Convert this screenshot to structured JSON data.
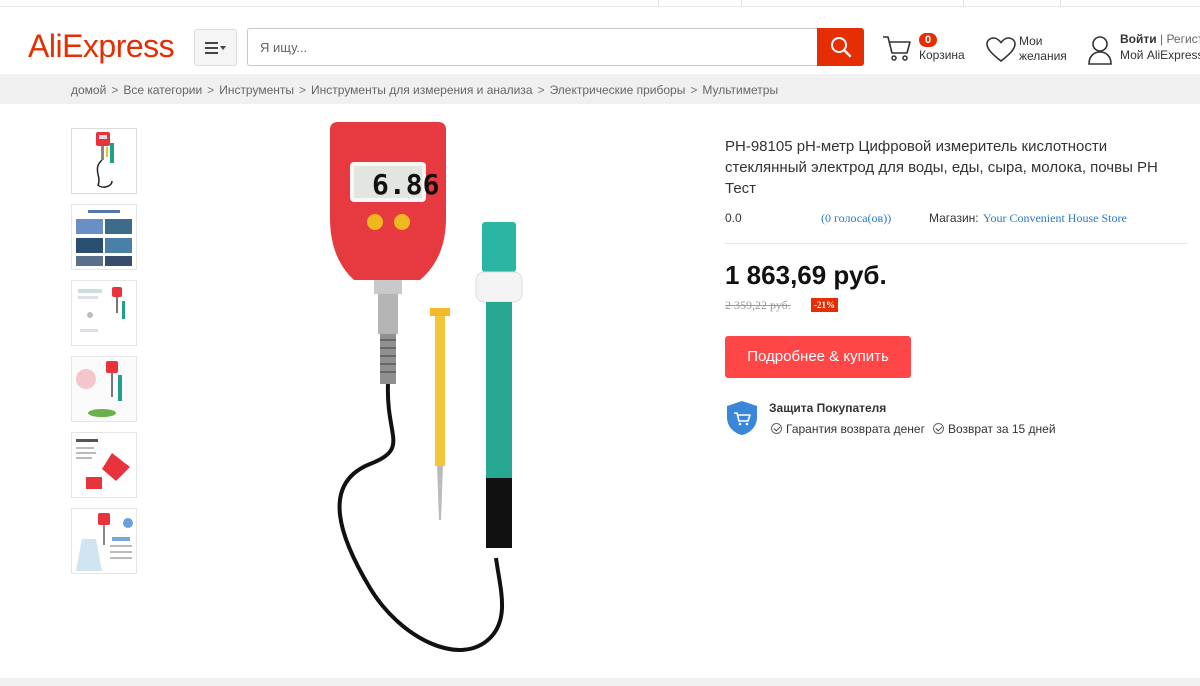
{
  "header": {
    "logo": "AliExpress",
    "search_placeholder": "Я ищу...",
    "cart_count": "0",
    "cart_label": "Корзина",
    "wishlist_line1": "Мои",
    "wishlist_line2": "желания",
    "signin": "Войти",
    "register": "Регистрация",
    "account": "Мой AliExpress"
  },
  "breadcrumb": {
    "items": [
      "домой",
      "Все категории",
      "Инструменты",
      "Инструменты для измерения и анализа",
      "Электрические приборы",
      "Мультиметры"
    ],
    "separator": ">"
  },
  "thumbnails": [
    {
      "name": "thumb-ph-meter"
    },
    {
      "name": "thumb-applicable-scenarios"
    },
    {
      "name": "thumb-pocket-digital"
    },
    {
      "name": "thumb-package"
    },
    {
      "name": "thumb-battery-install"
    },
    {
      "name": "thumb-lock-data"
    }
  ],
  "main_image": {
    "display_reading": "6.86"
  },
  "product": {
    "title": "PH-98105 pH-метр Цифровой измеритель кислотности стеклянный электрод для воды, еды, сыра, молока, почвы PH Тест",
    "rating": "0.0",
    "votes": "(0 голоса(ов))",
    "store_label": "Магазин:",
    "store_name": "Your Convenient House Store",
    "price": "1 863,69 руб.",
    "old_price": "2 359,22 руб.",
    "discount": "-21%",
    "buy_button": "Подробнее & купить",
    "protection_title": "Защита Покупателя",
    "guarantee_1": "Гарантия возврата денег",
    "guarantee_2": "Возврат за 15 дней"
  },
  "colors": {
    "brand": "#e62e04",
    "buy_button": "#ff4747",
    "link": "#2b7ac6",
    "shield": "#3a86d8"
  }
}
